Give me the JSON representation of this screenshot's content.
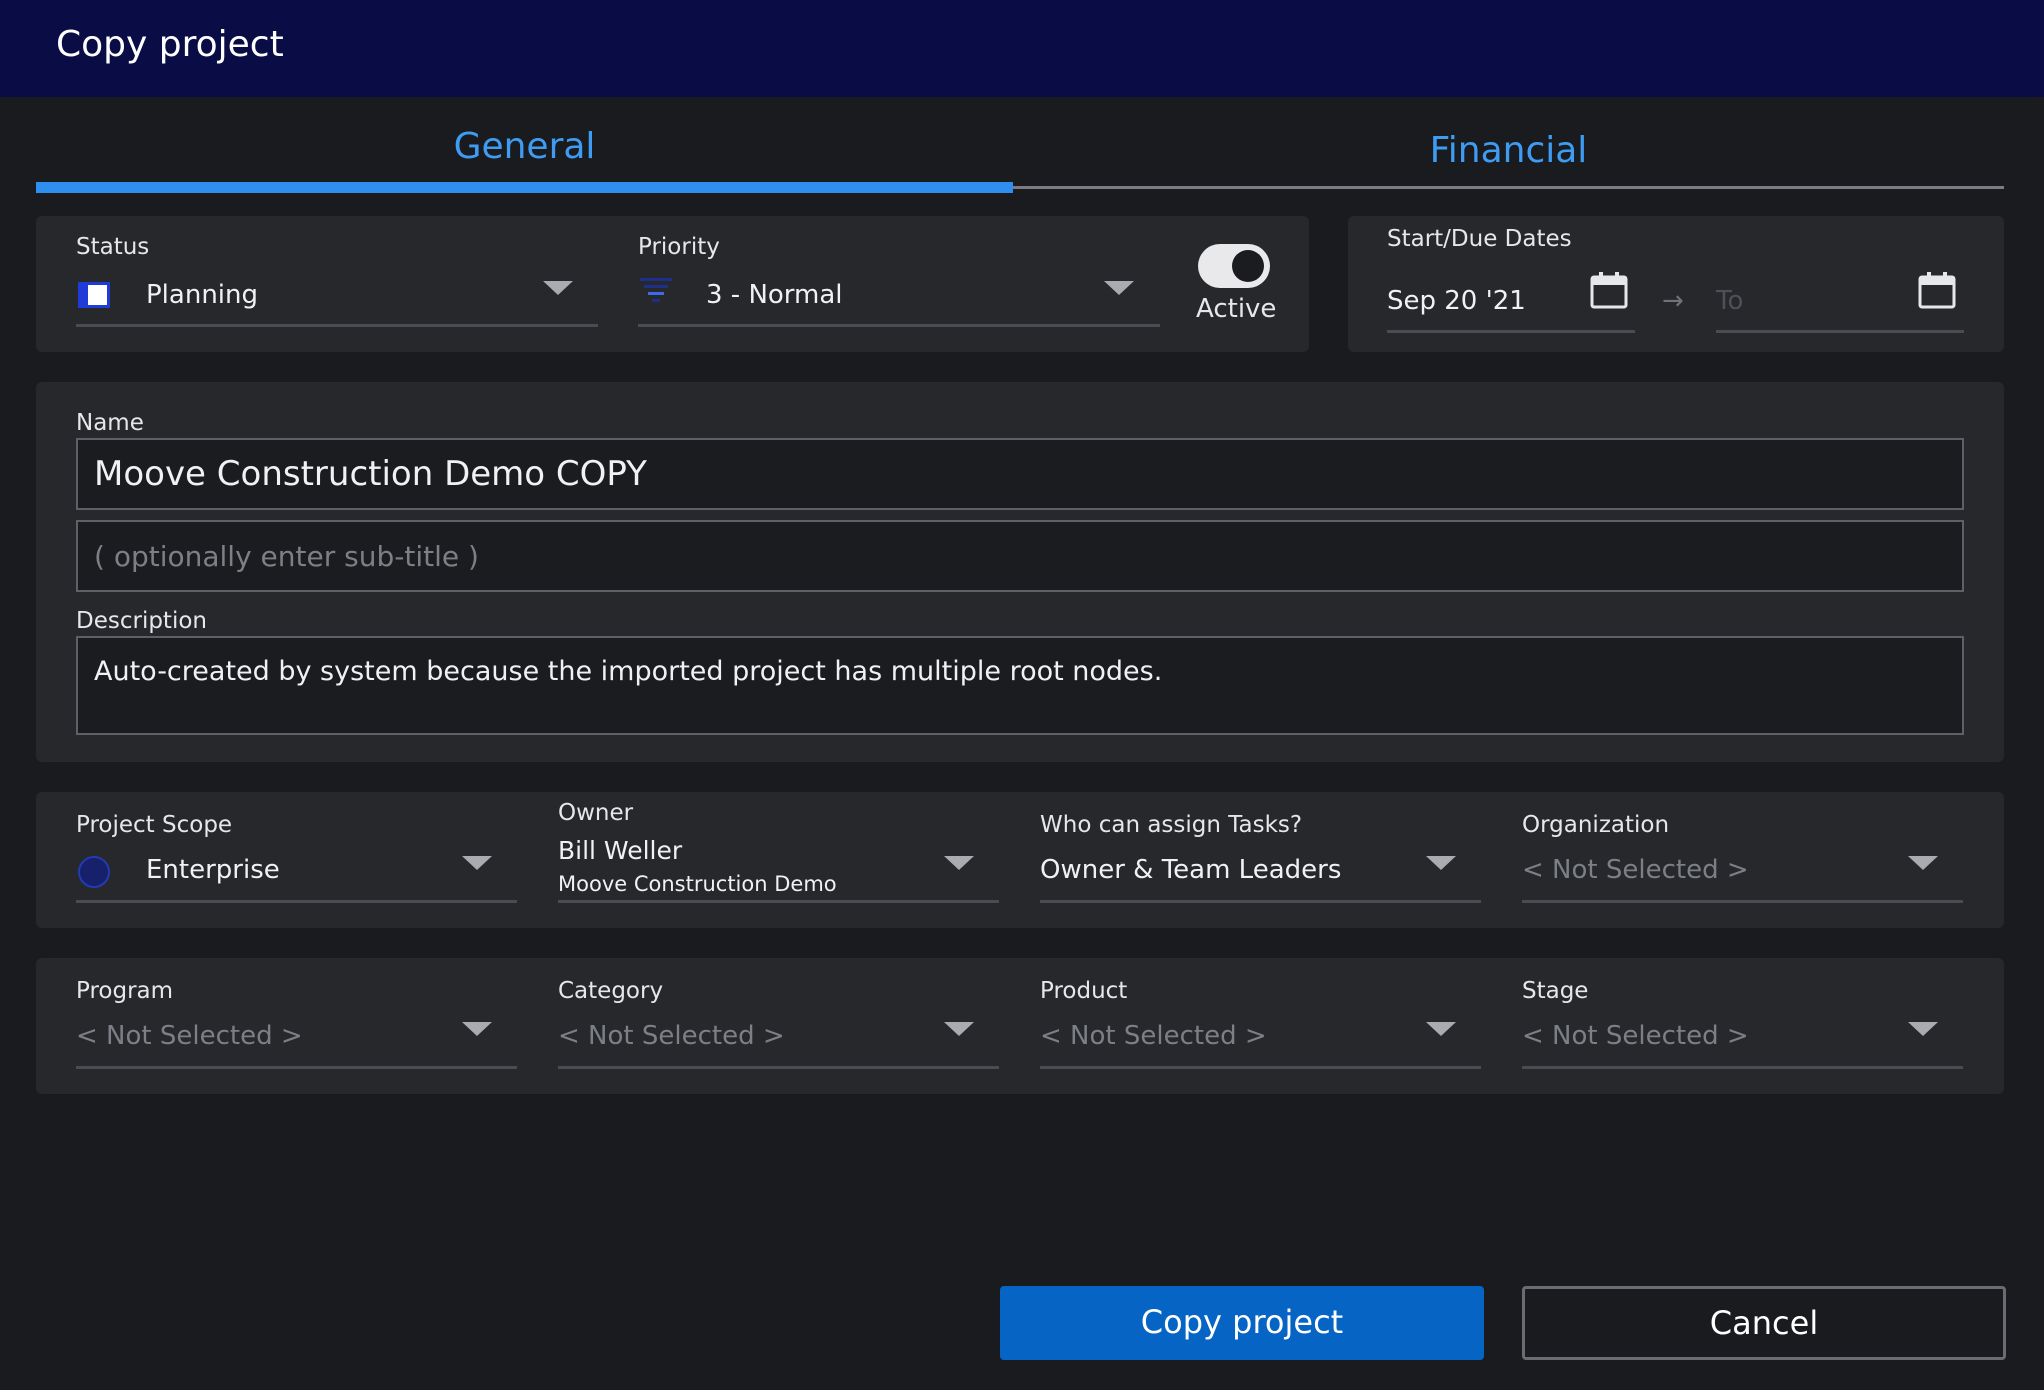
{
  "window": {
    "title": "Copy project"
  },
  "tabs": [
    {
      "label": "General",
      "active": true
    },
    {
      "label": "Financial",
      "active": false
    }
  ],
  "status": {
    "label": "Status",
    "value": "Planning",
    "icon": "planning-status-icon"
  },
  "priority": {
    "label": "Priority",
    "value": "3 - Normal",
    "icon": "priority-icon"
  },
  "active_toggle": {
    "label": "Active",
    "on": true
  },
  "dates": {
    "label": "Start/Due Dates",
    "start": "Sep 20 '21",
    "end_placeholder": "To",
    "arrow": "→"
  },
  "name": {
    "label": "Name",
    "value": "Moove Construction Demo COPY"
  },
  "subtitle": {
    "placeholder": "( optionally enter sub-title )"
  },
  "description": {
    "label": "Description",
    "value": "Auto-created by system because the imported project has multiple root nodes."
  },
  "project_scope": {
    "label": "Project Scope",
    "value": "Enterprise",
    "icon": "globe-icon"
  },
  "owner": {
    "label": "Owner",
    "name": "Bill Weller",
    "org": "Moove Construction Demo"
  },
  "assign_tasks": {
    "label": "Who can assign Tasks?",
    "value": "Owner & Team Leaders"
  },
  "organization": {
    "label": "Organization",
    "value": "< Not Selected >"
  },
  "program": {
    "label": "Program",
    "value": "< Not Selected >"
  },
  "category": {
    "label": "Category",
    "value": "< Not Selected >"
  },
  "product": {
    "label": "Product",
    "value": "< Not Selected >"
  },
  "stage": {
    "label": "Stage",
    "value": "< Not Selected >"
  },
  "buttons": {
    "copy": "Copy project",
    "cancel": "Cancel"
  },
  "colors": {
    "titlebar": "#0a0d45",
    "accent": "#2e8ff0",
    "primary_button": "#0664c4",
    "background": "#1a1b1e",
    "panel": "#27282c"
  }
}
